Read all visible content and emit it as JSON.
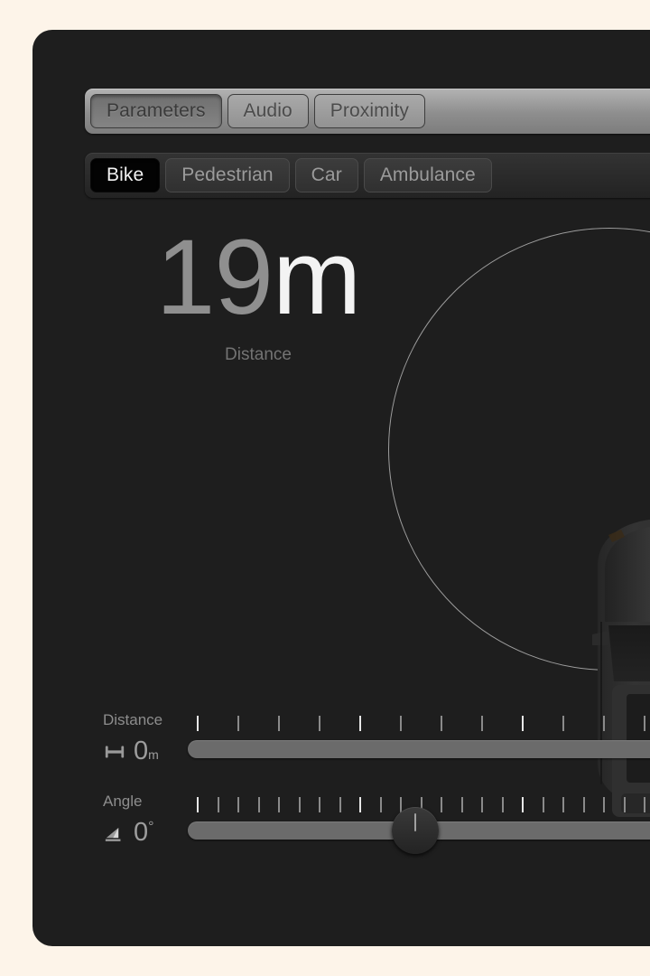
{
  "theme": {
    "page_background": "#fdf4e9",
    "panel_background": "#1e1e1e",
    "accent_text": "#f3f3f3",
    "muted_text": "#8d8d8d",
    "track_color": "#6b6b6b",
    "range_circle_color": "#b4b4b4",
    "selected_tab_background": "#030303"
  },
  "tabbar_primary": {
    "name": "mode-tabs",
    "selected": "Parameters",
    "items": [
      {
        "label": "Parameters",
        "selected": true
      },
      {
        "label": "Audio",
        "selected": false
      },
      {
        "label": "Proximity",
        "selected": false
      }
    ]
  },
  "tabbar_secondary": {
    "name": "object-tabs",
    "selected": "Bike",
    "items": [
      {
        "label": "Bike",
        "selected": true
      },
      {
        "label": "Pedestrian",
        "selected": false
      },
      {
        "label": "Car",
        "selected": false
      },
      {
        "label": "Ambulance",
        "selected": false
      }
    ]
  },
  "readout": {
    "value": "19",
    "unit": "m",
    "label": "Distance"
  },
  "sliders": [
    {
      "id": "distance",
      "title": "Distance",
      "icon": "dimension-line-icon",
      "value": "0",
      "unit": "m",
      "unit_style": "sub",
      "thumb_percent": 0,
      "ticks": 13,
      "major_every": 4,
      "thumb_visible": false
    },
    {
      "id": "angle",
      "title": "Angle",
      "icon": "angle-icon",
      "value": "0",
      "unit": "°",
      "unit_style": "deg",
      "thumb_percent": 45,
      "ticks": 25,
      "major_every": 8,
      "thumb_visible": true
    }
  ],
  "stage": {
    "range_circle_name": "proximity-range-circle",
    "vehicle_name": "car-top-down-graphic"
  }
}
